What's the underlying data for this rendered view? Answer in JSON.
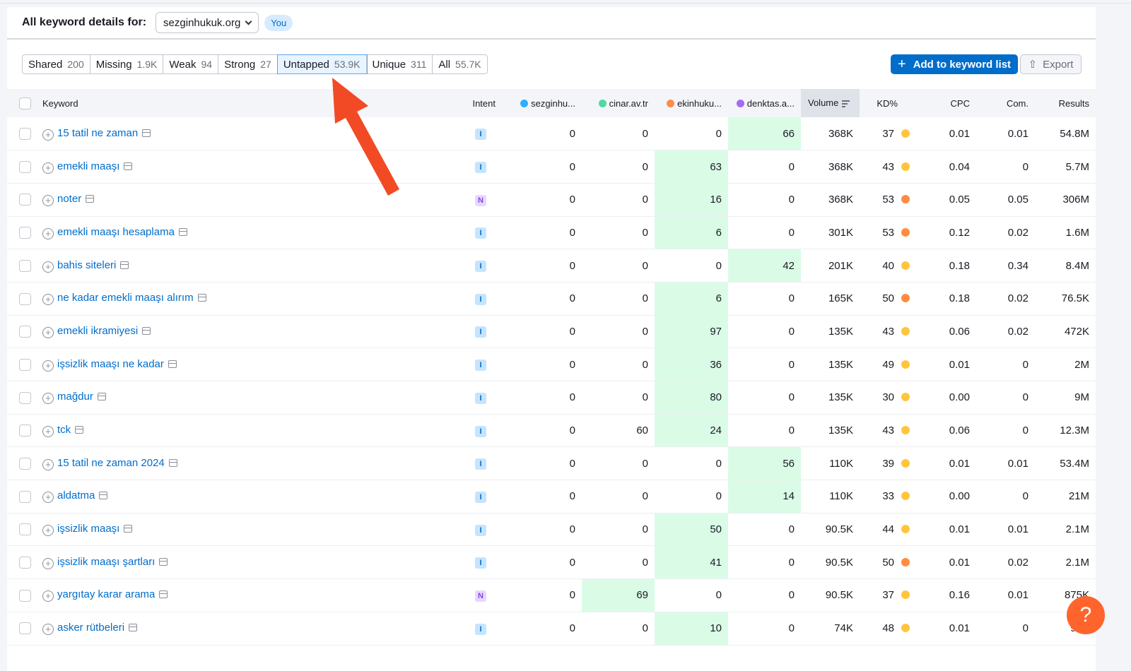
{
  "header": {
    "title": "All keyword details for:",
    "domain": "sezginhukuk.org",
    "you_badge": "You"
  },
  "tabs": [
    {
      "label": "Shared",
      "count": "200"
    },
    {
      "label": "Missing",
      "count": "1.9K"
    },
    {
      "label": "Weak",
      "count": "94"
    },
    {
      "label": "Strong",
      "count": "27"
    },
    {
      "label": "Untapped",
      "count": "53.9K",
      "active": true
    },
    {
      "label": "Unique",
      "count": "311"
    },
    {
      "label": "All",
      "count": "55.7K"
    }
  ],
  "toolbar": {
    "add_label": "Add to keyword list",
    "export_label": "Export"
  },
  "columns": {
    "keyword": "Keyword",
    "intent": "Intent",
    "c1": "sezginhu...",
    "c2": "cinar.av.tr",
    "c3": "ekinhuku...",
    "c4": "denktas.a...",
    "volume": "Volume",
    "kd": "KD%",
    "cpc": "CPC",
    "com": "Com.",
    "results": "Results"
  },
  "competitor_colors": [
    "#2bb0ff",
    "#4fd9a4",
    "#ff8c42",
    "#a56bf5"
  ],
  "kd_colors": {
    "medium": "#ffc53d",
    "hard": "#ff8c42"
  },
  "rows": [
    {
      "kw": "15 tatil ne zaman",
      "intent": "I",
      "c": [
        "0",
        "0",
        "0",
        "66"
      ],
      "hl": 3,
      "vol": "368K",
      "kd": "37",
      "kdc": "medium",
      "cpc": "0.01",
      "com": "0.01",
      "res": "54.8M"
    },
    {
      "kw": "emekli maaşı",
      "intent": "I",
      "c": [
        "0",
        "0",
        "63",
        "0"
      ],
      "hl": 2,
      "vol": "368K",
      "kd": "43",
      "kdc": "medium",
      "cpc": "0.04",
      "com": "0",
      "res": "5.7M"
    },
    {
      "kw": "noter",
      "intent": "N",
      "c": [
        "0",
        "0",
        "16",
        "0"
      ],
      "hl": 2,
      "vol": "368K",
      "kd": "53",
      "kdc": "hard",
      "cpc": "0.05",
      "com": "0.05",
      "res": "306M"
    },
    {
      "kw": "emekli maaşı hesaplama",
      "intent": "I",
      "c": [
        "0",
        "0",
        "6",
        "0"
      ],
      "hl": 2,
      "vol": "301K",
      "kd": "53",
      "kdc": "hard",
      "cpc": "0.12",
      "com": "0.02",
      "res": "1.6M"
    },
    {
      "kw": "bahis siteleri",
      "intent": "I",
      "c": [
        "0",
        "0",
        "0",
        "42"
      ],
      "hl": 3,
      "vol": "201K",
      "kd": "40",
      "kdc": "medium",
      "cpc": "0.18",
      "com": "0.34",
      "res": "8.4M"
    },
    {
      "kw": "ne kadar emekli maaşı alırım",
      "intent": "I",
      "c": [
        "0",
        "0",
        "6",
        "0"
      ],
      "hl": 2,
      "vol": "165K",
      "kd": "50",
      "kdc": "hard",
      "cpc": "0.18",
      "com": "0.02",
      "res": "76.5K"
    },
    {
      "kw": "emekli ikramiyesi",
      "intent": "I",
      "c": [
        "0",
        "0",
        "97",
        "0"
      ],
      "hl": 2,
      "vol": "135K",
      "kd": "43",
      "kdc": "medium",
      "cpc": "0.06",
      "com": "0.02",
      "res": "472K"
    },
    {
      "kw": "işsizlik maaşı ne kadar",
      "intent": "I",
      "c": [
        "0",
        "0",
        "36",
        "0"
      ],
      "hl": 2,
      "vol": "135K",
      "kd": "49",
      "kdc": "medium",
      "cpc": "0.01",
      "com": "0",
      "res": "2M"
    },
    {
      "kw": "mağdur",
      "intent": "I",
      "c": [
        "0",
        "0",
        "80",
        "0"
      ],
      "hl": 2,
      "vol": "135K",
      "kd": "30",
      "kdc": "medium",
      "cpc": "0.00",
      "com": "0",
      "res": "9M"
    },
    {
      "kw": "tck",
      "intent": "I",
      "c": [
        "0",
        "60",
        "24",
        "0"
      ],
      "hl": 2,
      "vol": "135K",
      "kd": "43",
      "kdc": "medium",
      "cpc": "0.06",
      "com": "0",
      "res": "12.3M"
    },
    {
      "kw": "15 tatil ne zaman 2024",
      "intent": "I",
      "c": [
        "0",
        "0",
        "0",
        "56"
      ],
      "hl": 3,
      "vol": "110K",
      "kd": "39",
      "kdc": "medium",
      "cpc": "0.01",
      "com": "0.01",
      "res": "53.4M"
    },
    {
      "kw": "aldatma",
      "intent": "I",
      "c": [
        "0",
        "0",
        "0",
        "14"
      ],
      "hl": 3,
      "vol": "110K",
      "kd": "33",
      "kdc": "medium",
      "cpc": "0.00",
      "com": "0",
      "res": "21M"
    },
    {
      "kw": "işsizlik maaşı",
      "intent": "I",
      "c": [
        "0",
        "0",
        "50",
        "0"
      ],
      "hl": 2,
      "vol": "90.5K",
      "kd": "44",
      "kdc": "medium",
      "cpc": "0.01",
      "com": "0.01",
      "res": "2.1M"
    },
    {
      "kw": "işsizlik maaşı şartları",
      "intent": "I",
      "c": [
        "0",
        "0",
        "41",
        "0"
      ],
      "hl": 2,
      "vol": "90.5K",
      "kd": "50",
      "kdc": "hard",
      "cpc": "0.01",
      "com": "0.02",
      "res": "2.1M"
    },
    {
      "kw": "yargıtay karar arama",
      "intent": "N",
      "c": [
        "0",
        "69",
        "0",
        "0"
      ],
      "hl": 1,
      "vol": "90.5K",
      "kd": "37",
      "kdc": "medium",
      "cpc": "0.16",
      "com": "0.01",
      "res": "875K"
    },
    {
      "kw": "asker rütbeleri",
      "intent": "I",
      "c": [
        "0",
        "0",
        "10",
        "0"
      ],
      "hl": 2,
      "vol": "74K",
      "kd": "48",
      "kdc": "medium",
      "cpc": "0.01",
      "com": "0",
      "res": "92K"
    }
  ],
  "help_label": "?"
}
